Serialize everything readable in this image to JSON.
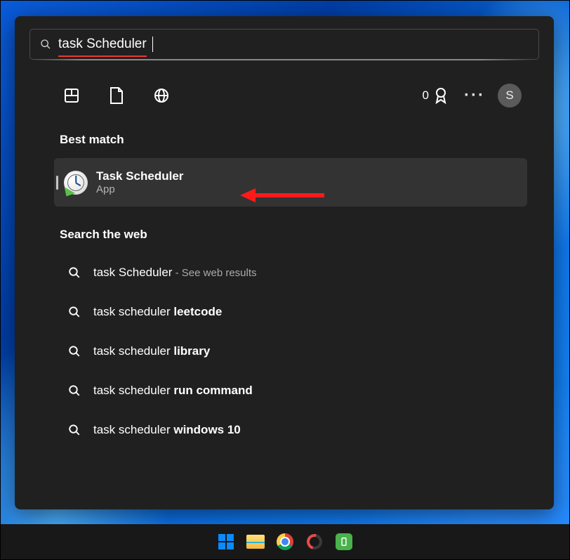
{
  "search": {
    "query": "task Scheduler"
  },
  "toolbar": {
    "points": "0",
    "avatar_letter": "S"
  },
  "sections": {
    "best_match_title": "Best match",
    "web_title": "Search the web"
  },
  "best_match": {
    "title": "Task Scheduler",
    "subtitle": "App"
  },
  "web_results": [
    {
      "prefix": "task Scheduler",
      "bold": "",
      "suffix": " - See web results"
    },
    {
      "prefix": "task scheduler ",
      "bold": "leetcode",
      "suffix": ""
    },
    {
      "prefix": "task scheduler ",
      "bold": "library",
      "suffix": ""
    },
    {
      "prefix": "task scheduler ",
      "bold": "run command",
      "suffix": ""
    },
    {
      "prefix": "task scheduler ",
      "bold": "windows 10",
      "suffix": ""
    }
  ]
}
